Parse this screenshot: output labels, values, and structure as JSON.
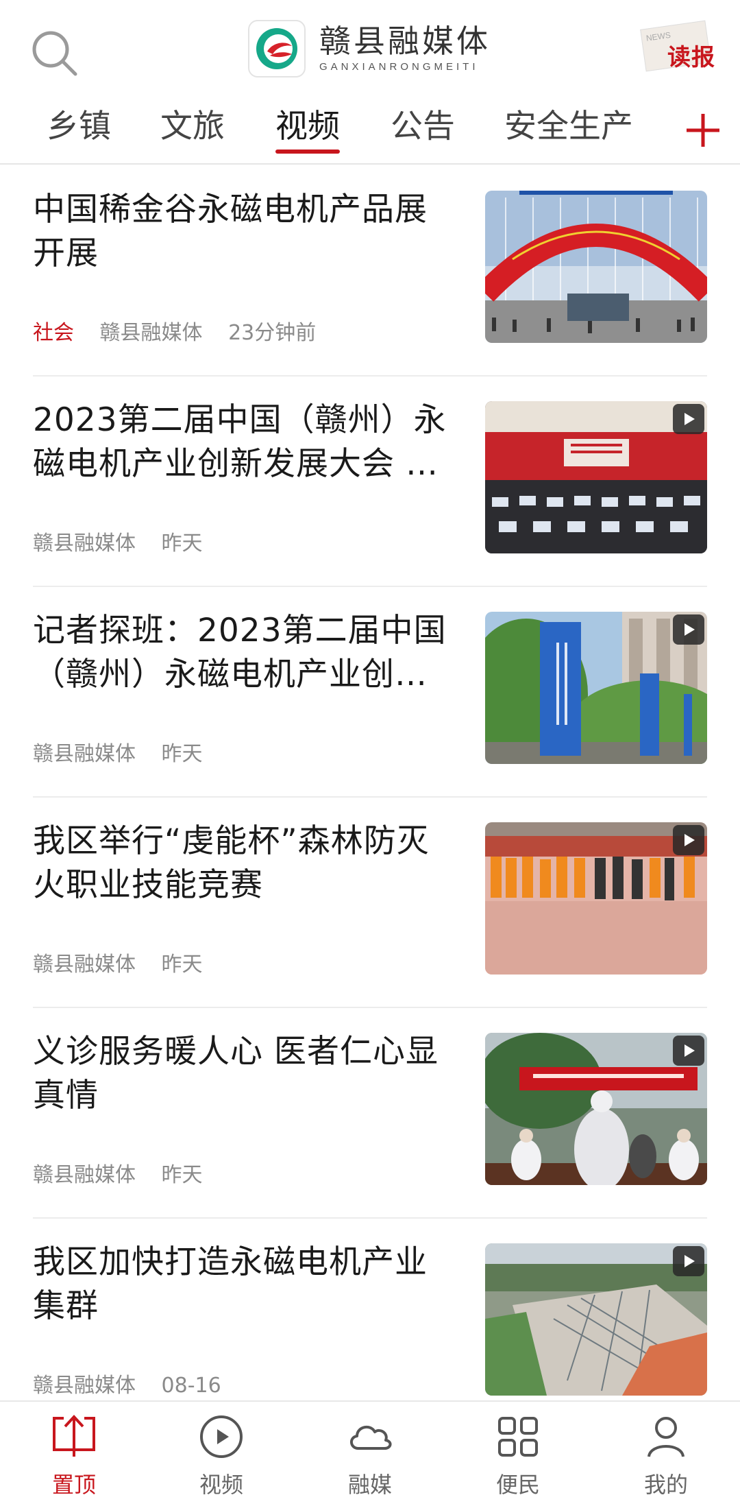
{
  "header": {
    "brand_name": "赣县融媒体",
    "brand_sub": "GANXIANRONGMEITI",
    "read_label": "读报",
    "read_paper_text": "NEWS",
    "search_icon": "search-icon",
    "accent_color": "#c8161d"
  },
  "tabs": [
    {
      "label": "乡镇"
    },
    {
      "label": "文旅"
    },
    {
      "label": "视频",
      "active": true
    },
    {
      "label": "公告"
    },
    {
      "label": "安全生产"
    }
  ],
  "feed": [
    {
      "title": "中国稀金谷永磁电机产品展开展",
      "category": "社会",
      "source": "赣县融媒体",
      "time": "23分钟前",
      "video": false
    },
    {
      "title": "2023第二届中国（赣州）永磁电机产业创新发展大会 …",
      "category": "",
      "source": "赣县融媒体",
      "time": "昨天",
      "video": true
    },
    {
      "title": "记者探班：2023第二届中国（赣州）永磁电机产业创…",
      "category": "",
      "source": "赣县融媒体",
      "time": "昨天",
      "video": true
    },
    {
      "title": "我区举行“虔能杯”森林防灭火职业技能竞赛",
      "category": "",
      "source": "赣县融媒体",
      "time": "昨天",
      "video": true
    },
    {
      "title": "义诊服务暖人心 医者仁心显真情",
      "category": "",
      "source": "赣县融媒体",
      "time": "昨天",
      "video": true
    },
    {
      "title": "我区加快打造永磁电机产业集群",
      "category": "",
      "source": "赣县融媒体",
      "time": "08-16",
      "video": true
    }
  ],
  "bottom_nav": [
    {
      "label": "置顶",
      "icon": "top-arrow-icon",
      "active": true
    },
    {
      "label": "视频",
      "icon": "play-circle-icon"
    },
    {
      "label": "融媒",
      "icon": "cloud-icon"
    },
    {
      "label": "便民",
      "icon": "grid-icon"
    },
    {
      "label": "我的",
      "icon": "user-icon"
    }
  ]
}
